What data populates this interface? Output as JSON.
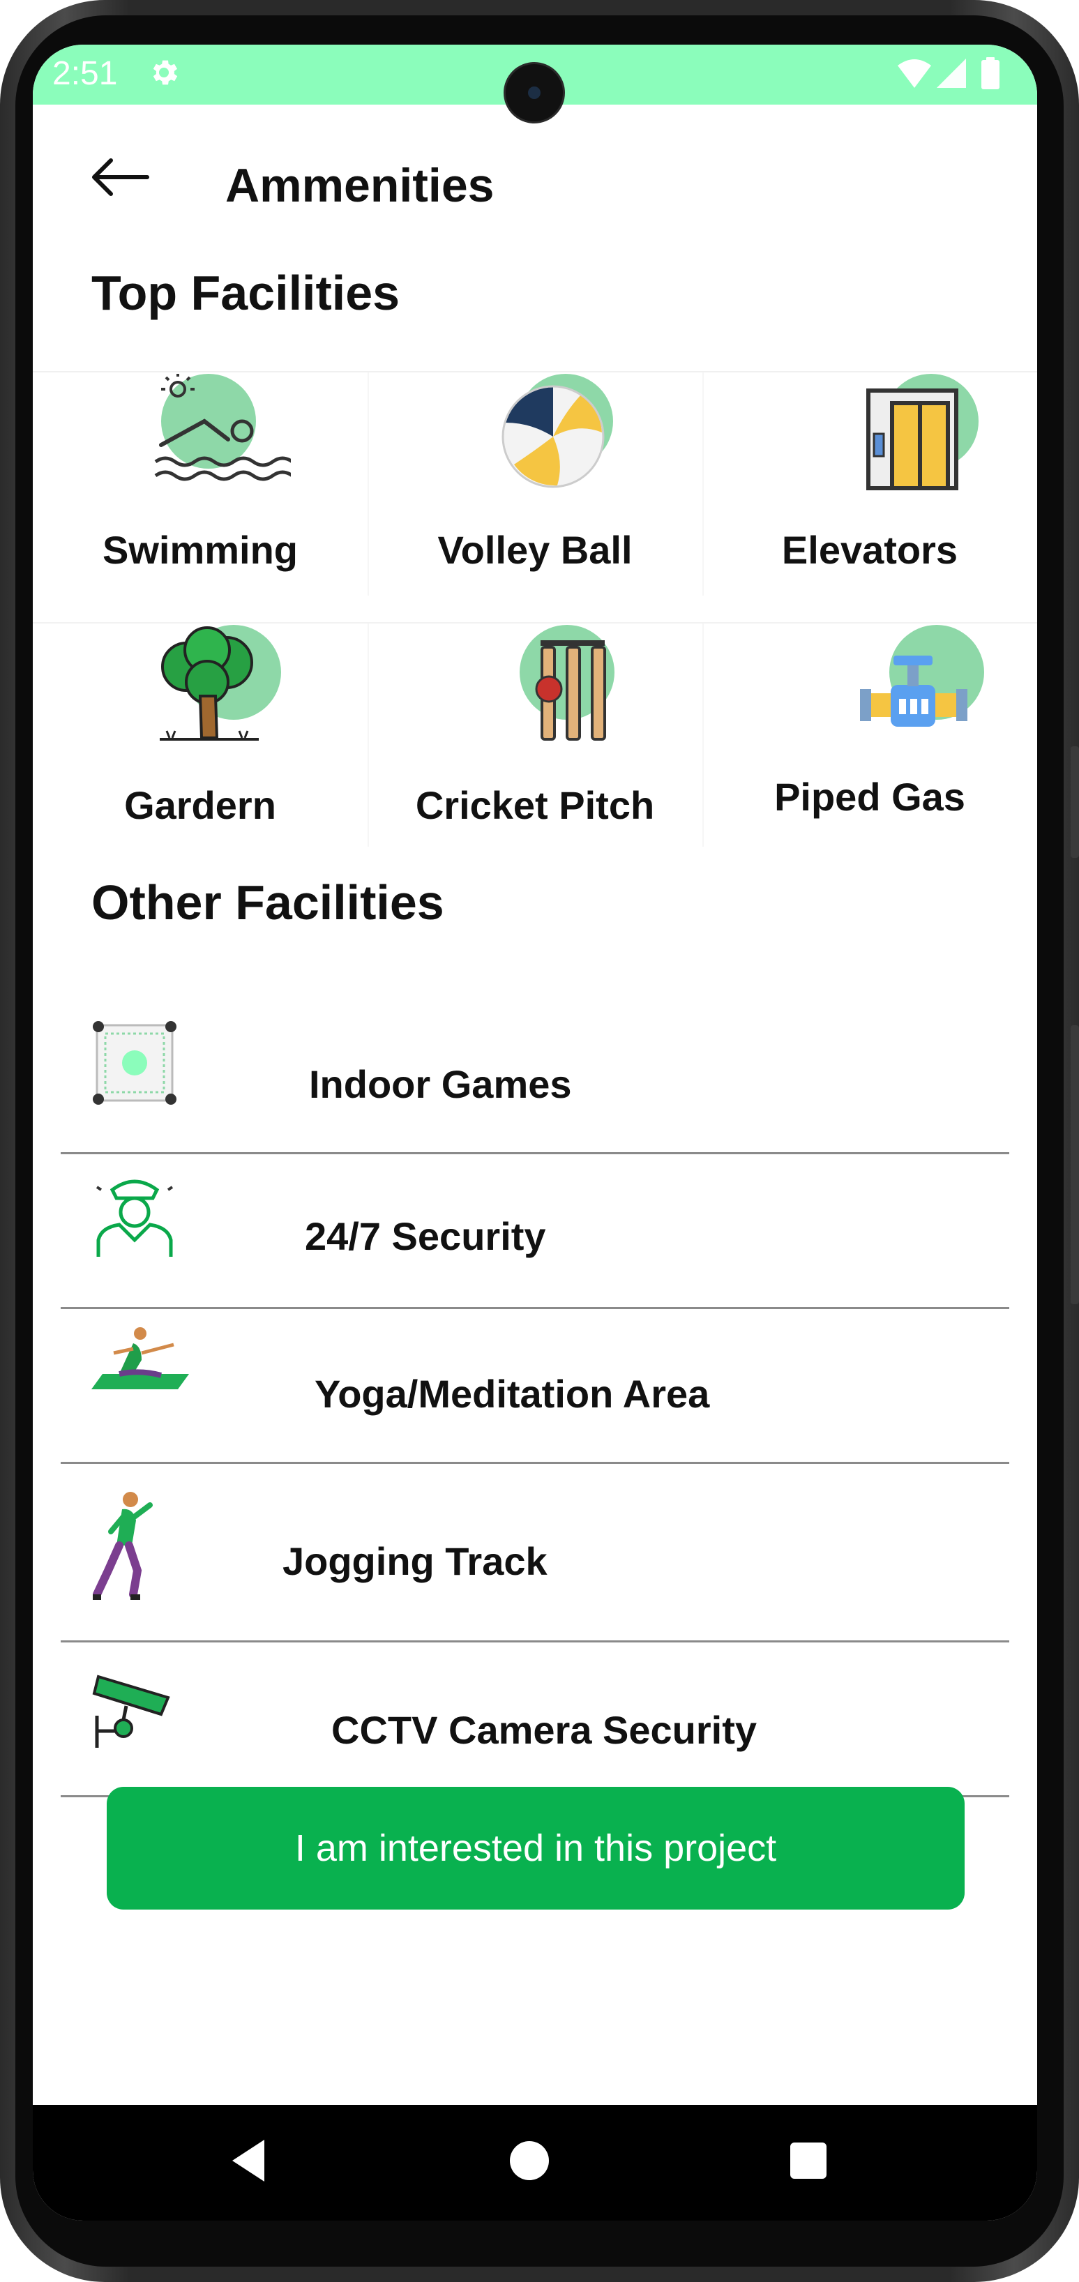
{
  "status_bar": {
    "time": "2:51"
  },
  "app_bar": {
    "title": "Ammenities"
  },
  "top_facilities": {
    "title": "Top Facilities",
    "items": [
      {
        "label": "Swimming",
        "icon": "swimming-icon"
      },
      {
        "label": "Volley Ball",
        "icon": "volleyball-icon"
      },
      {
        "label": "Elevators",
        "icon": "elevator-icon"
      },
      {
        "label": "Gardern",
        "icon": "tree-icon"
      },
      {
        "label": "Cricket Pitch",
        "icon": "cricket-stumps-icon"
      },
      {
        "label": "Piped Gas",
        "icon": "gas-pipe-icon"
      }
    ]
  },
  "other_facilities": {
    "title": "Other Facilities",
    "items": [
      {
        "label": "Indoor Games",
        "icon": "indoor-games-icon"
      },
      {
        "label": "24/7 Security",
        "icon": "security-guard-icon"
      },
      {
        "label": "Yoga/Meditation Area",
        "icon": "yoga-icon"
      },
      {
        "label": "Jogging Track",
        "icon": "jogging-icon"
      },
      {
        "label": "CCTV Camera Security",
        "icon": "cctv-icon"
      }
    ]
  },
  "cta": {
    "label": "I am interested in this project"
  },
  "colors": {
    "accent": "#09b14f",
    "status_bar": "#8bfdbb",
    "icon_bubble": "#8ed8a8"
  }
}
